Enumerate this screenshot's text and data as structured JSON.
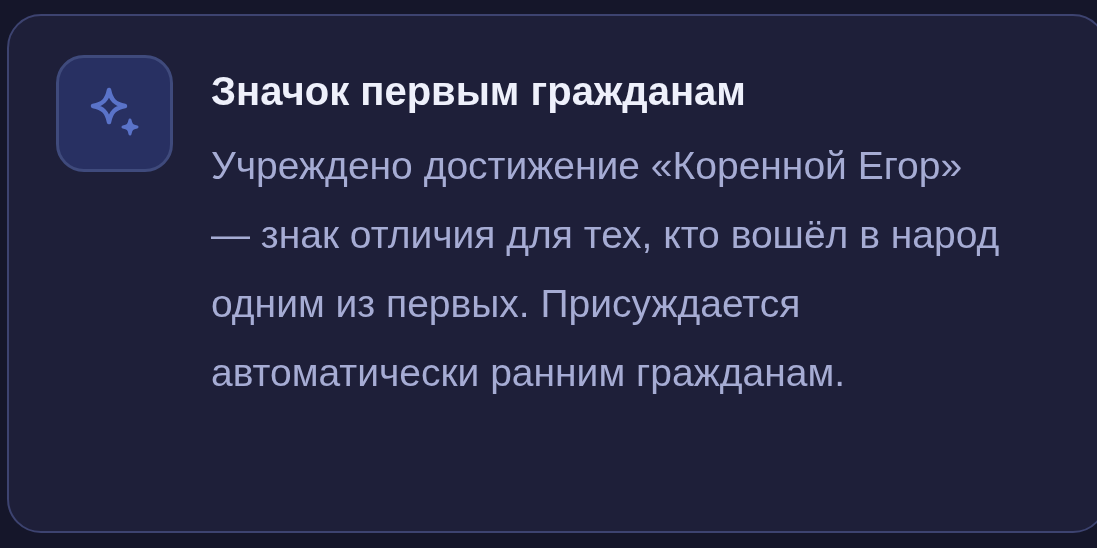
{
  "card": {
    "title": "Значок первым гражданам",
    "description": "Учреждено достижение «Коренной Егор» — знак отличия для тех, кто вошёл в народ одним из первых. Присуждается автоматически ранним гражданам."
  }
}
